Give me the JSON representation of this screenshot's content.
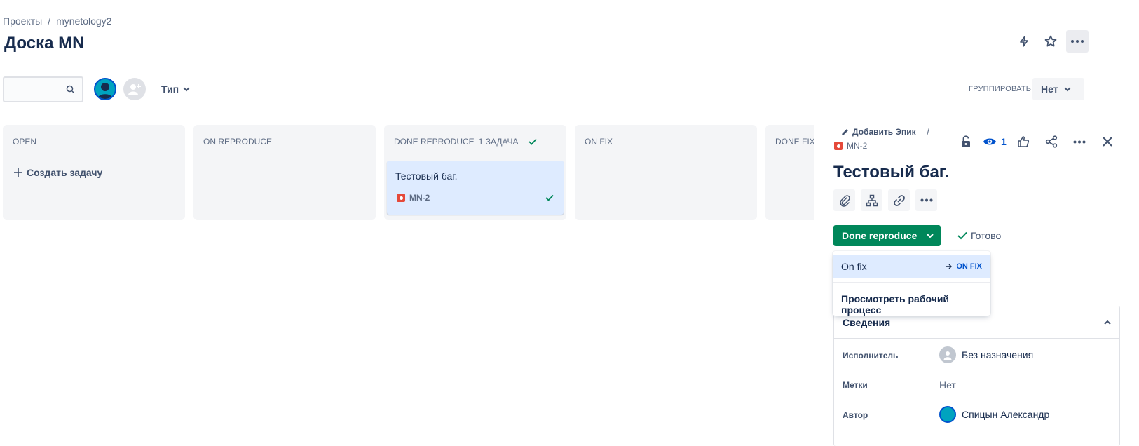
{
  "breadcrumb": {
    "projects": "Проекты",
    "separator": "/",
    "project": "mynetology2"
  },
  "page_title": "Доска MN",
  "toolbar": {
    "search_placeholder": "",
    "type_filter": "Тип",
    "group_label": "ГРУППИРОВАТЬ:",
    "group_value": "Нет"
  },
  "columns": [
    {
      "title": "OPEN",
      "create_label": "Создать задачу"
    },
    {
      "title": "ON REPRODUCE"
    },
    {
      "title": "DONE REPRODUCE",
      "count": "1 ЗАДАЧА"
    },
    {
      "title": "ON FIX"
    },
    {
      "title": "DONE FIX"
    }
  ],
  "card": {
    "title": "Тестовый баг.",
    "key": "MN-2"
  },
  "panel": {
    "add_epic": "Добавить Эпик",
    "slash": "/",
    "key": "MN-2",
    "watchers": "1",
    "title": "Тестовый баг.",
    "status": "Done reproduce",
    "resolution": "Готово",
    "details": {
      "heading": "Сведения",
      "assignee_label": "Исполнитель",
      "assignee_value": "Без назначения",
      "labels_label": "Метки",
      "labels_value": "Нет",
      "reporter_label": "Автор",
      "reporter_value": "Спицын Александр"
    }
  },
  "dropdown": {
    "transition": "On fix",
    "target": "ON FIX",
    "workflow": "Просмотреть рабочий процесс"
  },
  "colors": {
    "accent": "#0052cc",
    "success": "#00875a",
    "bug": "#e5493a",
    "selected": "#deebff"
  }
}
